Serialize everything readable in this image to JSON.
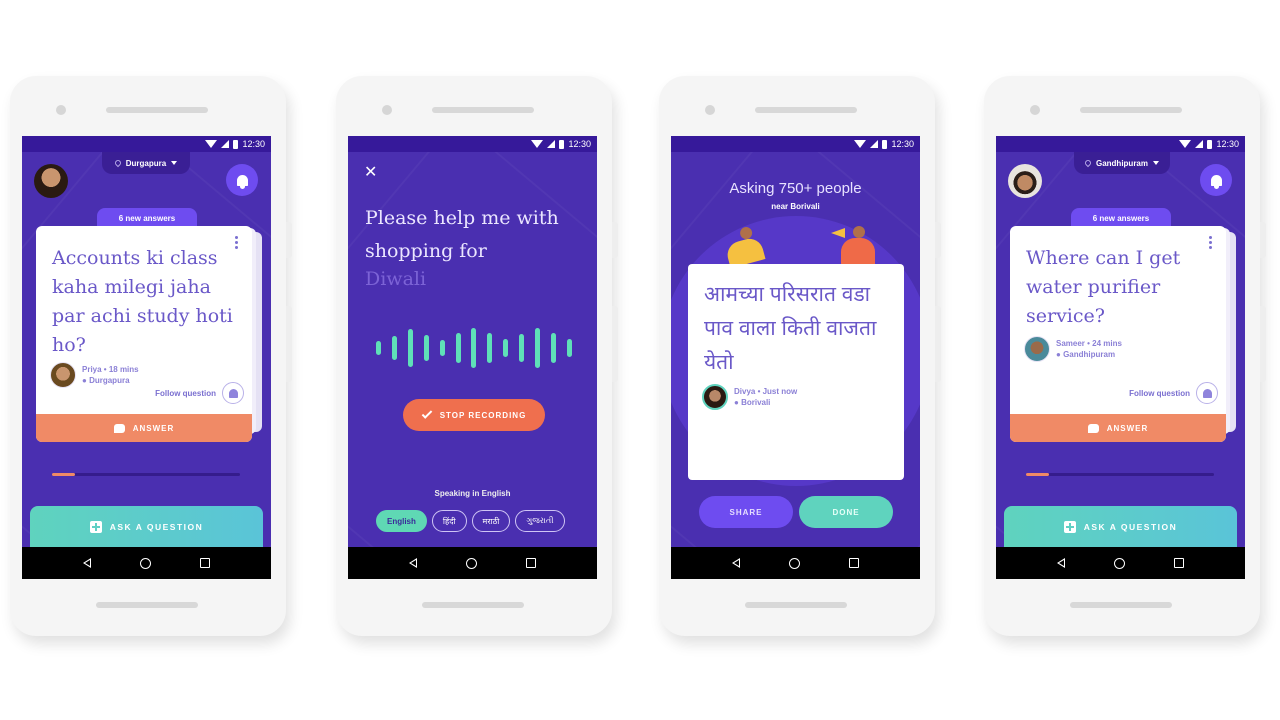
{
  "status_bar": {
    "time": "12:30"
  },
  "nav": {
    "back": "back-icon",
    "home": "home-icon",
    "recent": "recent-apps-icon"
  },
  "phones": [
    {
      "screen": "question-feed",
      "location": "Durgapura",
      "new_answers": "6 new answers",
      "question": "Accounts ki class kaha milegi jaha par achi study hoti ho?",
      "asker": "Priya • 18 mins",
      "asker_location": "Durgapura",
      "follow_label": "Follow question",
      "answer_label": "ANSWER",
      "progress": 0.12,
      "ask_label": "ASK A QUESTION"
    },
    {
      "screen": "voice-input",
      "prompt": "Please help me with shopping for",
      "prompt_partial": "Diwali",
      "stop_label": "STOP RECORDING",
      "speaking_label": "Speaking in English",
      "languages": [
        "English",
        "हिंदी",
        "मराठी",
        "ગુજરાતી"
      ],
      "active_language": "English"
    },
    {
      "screen": "broadcast",
      "asking": "Asking 750+ people",
      "near": "near Borivali",
      "question": "आमच्या परिसरात वडा पाव वाला किती वाजता येतो",
      "asker": "Divya • Just now",
      "asker_location": "Borivali",
      "share_label": "SHARE",
      "done_label": "DONE"
    },
    {
      "screen": "question-feed",
      "location": "Gandhipuram",
      "new_answers": "6 new answers",
      "question": "Where can I get water purifier service?",
      "asker": "Sameer • 24 mins",
      "asker_location": "Gandhipuram",
      "follow_label": "Follow question",
      "answer_label": "ANSWER",
      "progress": 0.12,
      "ask_label": "ASK A QUESTION"
    }
  ],
  "colors": {
    "primary": "#4a2fb0",
    "accent_orange": "#f08a66",
    "accent_teal": "#5fd3be",
    "button_purple": "#6e4cf0"
  }
}
